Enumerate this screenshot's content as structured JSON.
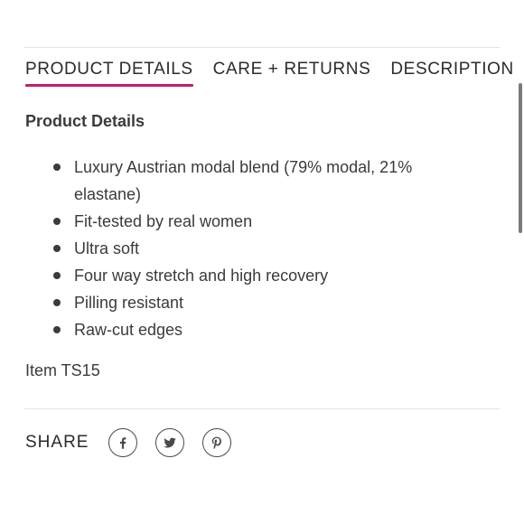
{
  "tabs": [
    {
      "label": "PRODUCT DETAILS",
      "active": true
    },
    {
      "label": "CARE + RETURNS",
      "active": false
    },
    {
      "label": "DESCRIPTION",
      "active": false
    }
  ],
  "colors": {
    "accent": "#c0206a",
    "text": "#3b3b3b"
  },
  "section": {
    "heading": "Product Details",
    "features": [
      "Luxury Austrian modal blend (79% modal, 21% elastane)",
      "Fit-tested by real women",
      "Ultra soft",
      "Four way stretch and high recovery",
      "Pilling resistant",
      "Raw-cut edges"
    ],
    "item_code": "Item TS15"
  },
  "share": {
    "label": "SHARE",
    "icons": [
      "facebook-icon",
      "twitter-icon",
      "pinterest-icon"
    ]
  }
}
